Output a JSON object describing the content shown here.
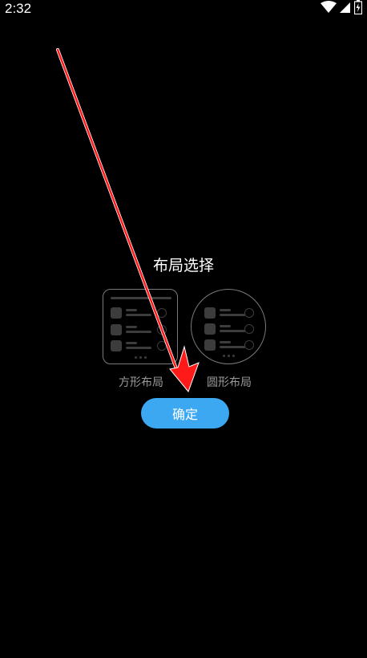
{
  "status_bar": {
    "time": "2:32",
    "icons": [
      "wifi-icon",
      "cellular-signal-icon",
      "battery-charging-icon"
    ]
  },
  "dialog": {
    "title": "布局选择",
    "options": [
      {
        "label": "方形布局",
        "shape": "square"
      },
      {
        "label": "圆形布局",
        "shape": "round"
      }
    ],
    "confirm_label": "确定"
  },
  "colors": {
    "background": "#000000",
    "accent": "#3da8f2",
    "annotation_arrow": "#ff1a1a"
  }
}
